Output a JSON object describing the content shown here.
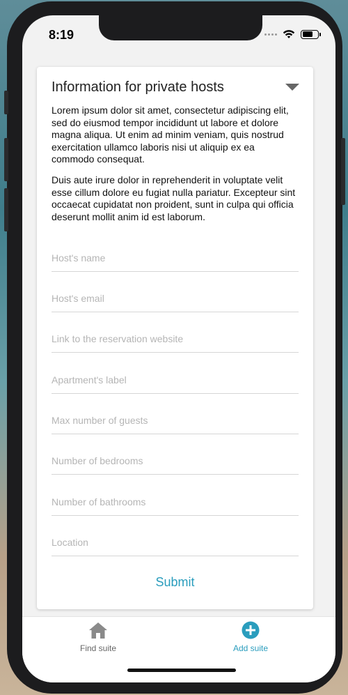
{
  "status": {
    "time": "8:19"
  },
  "card": {
    "title": "Information for private hosts",
    "paragraphs": [
      "Lorem ipsum dolor sit amet, consectetur adipiscing elit, sed do eiusmod tempor incididunt ut labore et dolore magna aliqua. Ut enim ad minim veniam, quis nostrud exercitation ullamco laboris nisi ut aliquip ex ea commodo consequat.",
      "Duis aute irure dolor in reprehenderit in voluptate velit esse cillum dolore eu fugiat nulla pariatur. Excepteur sint occaecat cupidatat non proident, sunt in culpa qui officia deserunt mollit anim id est laborum."
    ],
    "fields": [
      {
        "placeholder": "Host's name",
        "value": ""
      },
      {
        "placeholder": "Host's email",
        "value": ""
      },
      {
        "placeholder": "Link to the reservation website",
        "value": ""
      },
      {
        "placeholder": "Apartment's label",
        "value": ""
      },
      {
        "placeholder": "Max number of guests",
        "value": ""
      },
      {
        "placeholder": "Number of bedrooms",
        "value": ""
      },
      {
        "placeholder": "Number of bathrooms",
        "value": ""
      },
      {
        "placeholder": "Location",
        "value": ""
      }
    ],
    "submit_label": "Submit"
  },
  "tabs": [
    {
      "label": "Find suite",
      "icon": "home-icon",
      "active": false
    },
    {
      "label": "Add suite",
      "icon": "add-circle-icon",
      "active": true
    }
  ],
  "colors": {
    "accent": "#2a9dbd",
    "inactive_tab": "#666666",
    "placeholder": "#b5b5b5"
  }
}
